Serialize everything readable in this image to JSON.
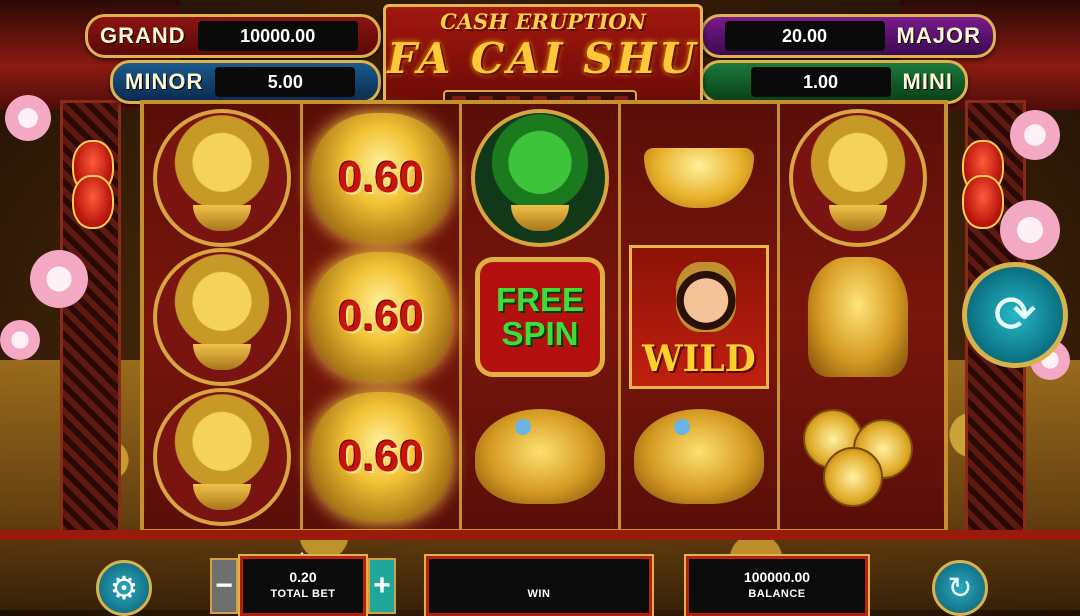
{
  "jackpots": {
    "grand": {
      "label": "GRAND",
      "value": "10000.00"
    },
    "minor": {
      "label": "MINOR",
      "value": "5.00"
    },
    "major": {
      "label": "MAJOR",
      "value": "20.00"
    },
    "mini": {
      "label": "MINI",
      "value": "1.00"
    }
  },
  "title": {
    "subtitle": "CASH ERUPTION",
    "main": "FA CAI SHU"
  },
  "reels": {
    "prize_values": [
      "0.60",
      "0.60",
      "0.60"
    ],
    "free_spin_line1": "FREE",
    "free_spin_line2": "SPIN",
    "wild_label": "WILD"
  },
  "controls": {
    "total_bet_value": "0.20",
    "total_bet_label": "TOTAL BET",
    "win_label": "WIN",
    "balance_value": "100000.00",
    "balance_label": "BALANCE",
    "minus_label": "−",
    "plus_label": "+"
  },
  "colors": {
    "accent_gold": "#e0b24c",
    "reel_red": "#7a160c",
    "spin_teal": "#0b6f80"
  },
  "icons": [
    "settings-gear-icon",
    "spin-arrow-icon",
    "autospin-icon"
  ]
}
